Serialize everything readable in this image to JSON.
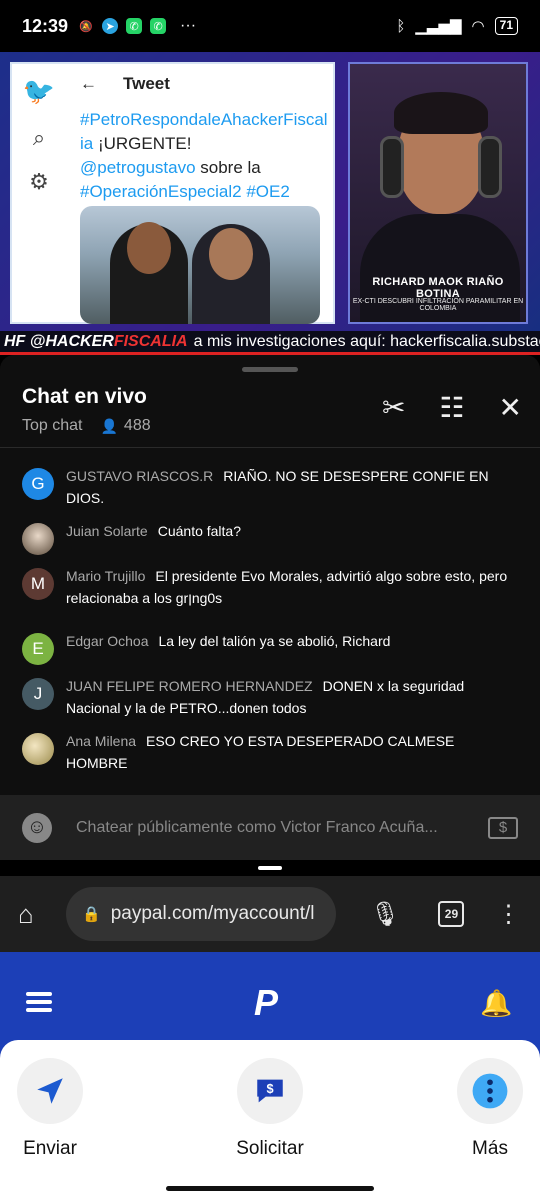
{
  "status_bar": {
    "time": "12:39",
    "battery": "71",
    "more": "···"
  },
  "video": {
    "tweet": {
      "header": "Tweet",
      "hashtag1": "#PetroRespondaleAhackerFiscalia",
      "text1": " ¡URGENTE!",
      "mention": "@petrogustavo",
      "text2": " sobre la",
      "hashtag2": "#OperaciónEspecial2",
      "hashtag3": "#OE2"
    },
    "cam_name": "RICHARD MAOK RIAÑO BOTINA",
    "cam_subtitle": "EX-CTI DESCUBRI INFILTRACIÓN PARAMILITAR EN COLOMBIA",
    "ticker_brand_1": "HF @HACKER",
    "ticker_brand_2": "FISCALIA",
    "ticker_text": " a mis investigaciones aquí: hackerfiscalia.substack.com"
  },
  "chat": {
    "title": "Chat en vivo",
    "mode": "Top chat",
    "viewer_count": "488",
    "messages": [
      {
        "initial": "G",
        "color": "#1e88e5",
        "author": "GUSTAVO RIASCOS.R",
        "text": "RIAÑO. NO SE DESESPERE CONFIE EN DIOS."
      },
      {
        "initial": "",
        "color": "#7a6a5a",
        "author": "Juian Solarte",
        "text": "Cuánto falta?"
      },
      {
        "initial": "M",
        "color": "#5d3a33",
        "author": "Mario Trujillo",
        "text": "El presidente Evo Morales, advirtió algo sobre esto, pero relacionaba a los grןng0s"
      },
      {
        "initial": "E",
        "color": "#7cb342",
        "author": "Edgar Ochoa",
        "text": "La ley del talión ya se abolió, Richard"
      },
      {
        "initial": "J",
        "color": "#455a64",
        "author": "JUAN FELIPE ROMERO HERNANDEZ",
        "text": "DONEN x la seguridad Nacional y la de PETRO...donen todos"
      },
      {
        "initial": "",
        "color": "#c9b37a",
        "author": "Ana Milena",
        "text": "ESO CREO YO ESTA DESEPERADO CALMESE HOMBRE"
      }
    ],
    "input_placeholder": "Chatear públicamente como Victor Franco Acuña...",
    "super_chat_symbol": "$"
  },
  "browser": {
    "url": "paypal.com/myaccount/l",
    "tab_count": "29"
  },
  "paypal": {
    "logo": "P",
    "actions": [
      {
        "label": "Enviar",
        "icon": "send-icon"
      },
      {
        "label": "Solicitar",
        "icon": "request-icon"
      },
      {
        "label": "Más",
        "icon": "more-icon"
      }
    ]
  }
}
